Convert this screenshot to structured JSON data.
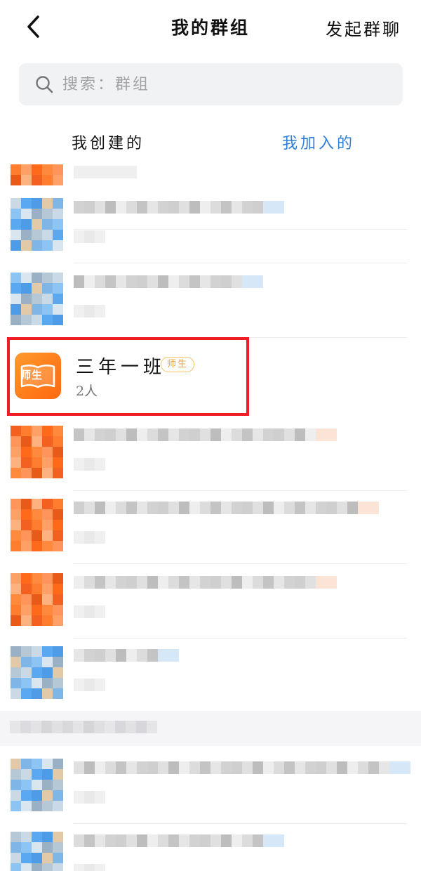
{
  "header": {
    "title": "我的群组",
    "start_chat": "发起群聊",
    "back_icon": "chevron-left-icon"
  },
  "search": {
    "placeholder": "搜索：群组",
    "icon": "search-icon"
  },
  "tabs": [
    {
      "label": "我创建的",
      "active": false
    },
    {
      "label": "我加入的",
      "active": true
    }
  ],
  "colors": {
    "accent": "#2e7fd8",
    "highlight": "#ee1c25",
    "badge": "#e8a53c",
    "avatar_orange": "#ff7a1a"
  },
  "highlighted_group": {
    "name": "三年一班",
    "badge": "师生",
    "members": "2人",
    "avatar_label": "师生"
  }
}
